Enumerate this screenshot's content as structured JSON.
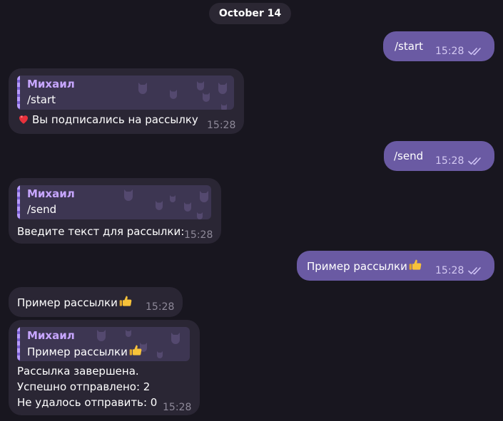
{
  "date_label": "October 14",
  "sender_name": "Михаил",
  "messages": [
    {
      "text": "/start",
      "time": "15:28"
    },
    {
      "reply_to": "/start",
      "text": "Вы подписались на рассылку",
      "emoji_prefix": "heart-icon",
      "time": "15:28"
    },
    {
      "text": "/send",
      "time": "15:28"
    },
    {
      "reply_to": "/send",
      "text": "Введите текст для рассылки:",
      "time": "15:28"
    },
    {
      "text": "Пример рассылки",
      "emoji_suffix": "thumbs-up-icon",
      "time": "15:28"
    },
    {
      "text": "Пример рассылки",
      "emoji_suffix": "thumbs-up-icon",
      "time": "15:28"
    },
    {
      "reply_to": "Пример рассылки",
      "lines": [
        "Рассылка завершена.",
        "Успешно отправлено: 2",
        "Не удалось отправить: 0"
      ],
      "time": "15:28"
    }
  ],
  "colors": {
    "background": "#18161f",
    "outgoing_bubble": "#6a5aa3",
    "incoming_bubble": "#2a2634",
    "reply_accent": "#c7a6ff"
  }
}
